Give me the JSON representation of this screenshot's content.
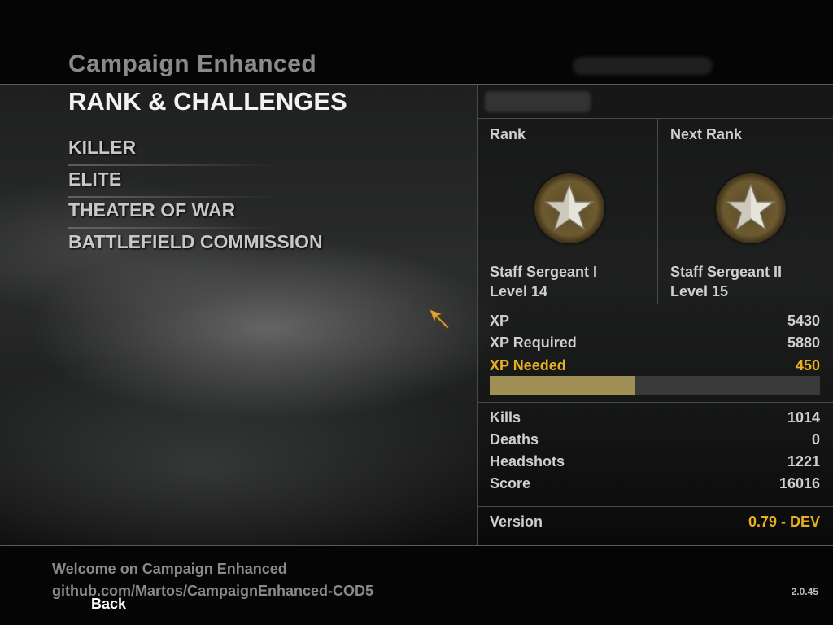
{
  "header": {
    "game_title": "Campaign Enhanced",
    "page_title": "RANK & CHALLENGES"
  },
  "menu": {
    "items": [
      {
        "label": "KILLER"
      },
      {
        "label": "ELITE"
      },
      {
        "label": "THEATER OF WAR"
      },
      {
        "label": "BATTLEFIELD COMMISSION"
      }
    ]
  },
  "rank": {
    "current_label": "Rank",
    "next_label": "Next Rank",
    "current_name": "Staff Sergeant I",
    "current_level": "Level 14",
    "next_name": "Staff Sergeant II",
    "next_level": "Level 15",
    "current_icon": "star-medal-icon",
    "next_icon": "star-medal-icon"
  },
  "xp": {
    "xp_label": "XP",
    "xp_value": "5430",
    "required_label": "XP Required",
    "required_value": "5880",
    "needed_label": "XP Needed",
    "needed_value": "450",
    "progress_fraction": 0.44
  },
  "stats": [
    {
      "label": "Kills",
      "value": "1014"
    },
    {
      "label": "Deaths",
      "value": "0"
    },
    {
      "label": "Headshots",
      "value": "1221"
    },
    {
      "label": "Score",
      "value": "16016"
    }
  ],
  "version": {
    "label": "Version",
    "value": "0.79 - DEV"
  },
  "footer": {
    "welcome": "Welcome on Campaign Enhanced",
    "url": "github.com/Martos/CampaignEnhanced-COD5",
    "back_label": "Back",
    "build": "2.0.45"
  },
  "colors": {
    "accent_gold": "#e8b020",
    "xp_bar_fill": "#a08f55"
  }
}
